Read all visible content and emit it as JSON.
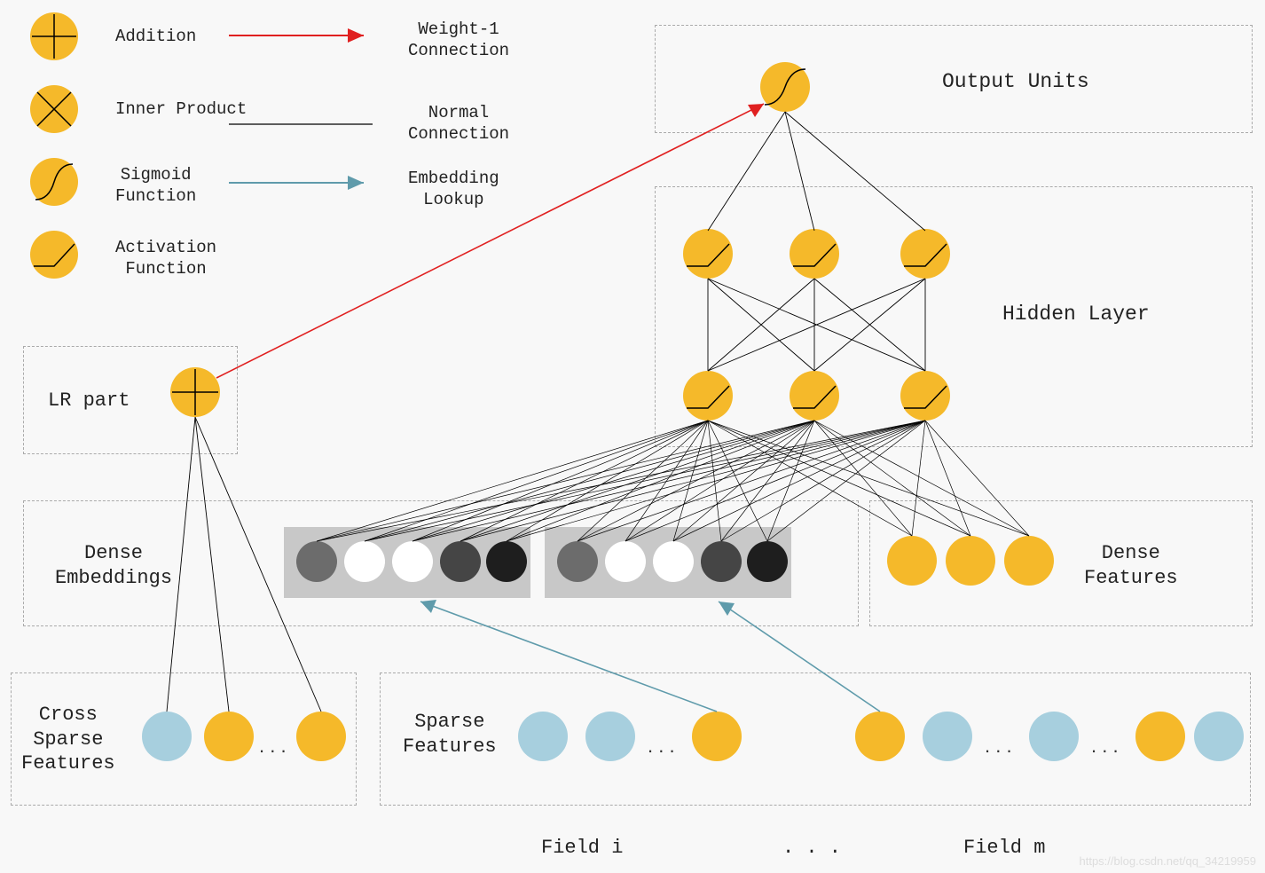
{
  "legend": {
    "addition": "Addition",
    "inner_product": "Inner Product",
    "sigmoid": "Sigmoid\nFunction",
    "activation": "Activation\nFunction",
    "weight1": "Weight-1\nConnection",
    "normal": "Normal\nConnection",
    "embedding": "Embedding\nLookup"
  },
  "labels": {
    "output_units": "Output Units",
    "hidden_layer": "Hidden Layer",
    "lr_part": "LR part",
    "dense_embeddings": "Dense\nEmbeddings",
    "dense_features": "Dense\nFeatures",
    "cross_sparse": "Cross\nSparse\nFeatures",
    "sparse_features": "Sparse\nFeatures",
    "field_i": "Field i",
    "field_m": "Field m",
    "field_dots": ". . ."
  },
  "colors": {
    "orange": "#f5b92a",
    "blue": "#a7cfde",
    "red": "#e02020",
    "teal": "#5f9bab",
    "box": "#c8c8c8"
  },
  "watermark": "https://blog.csdn.net/qq_34219959"
}
